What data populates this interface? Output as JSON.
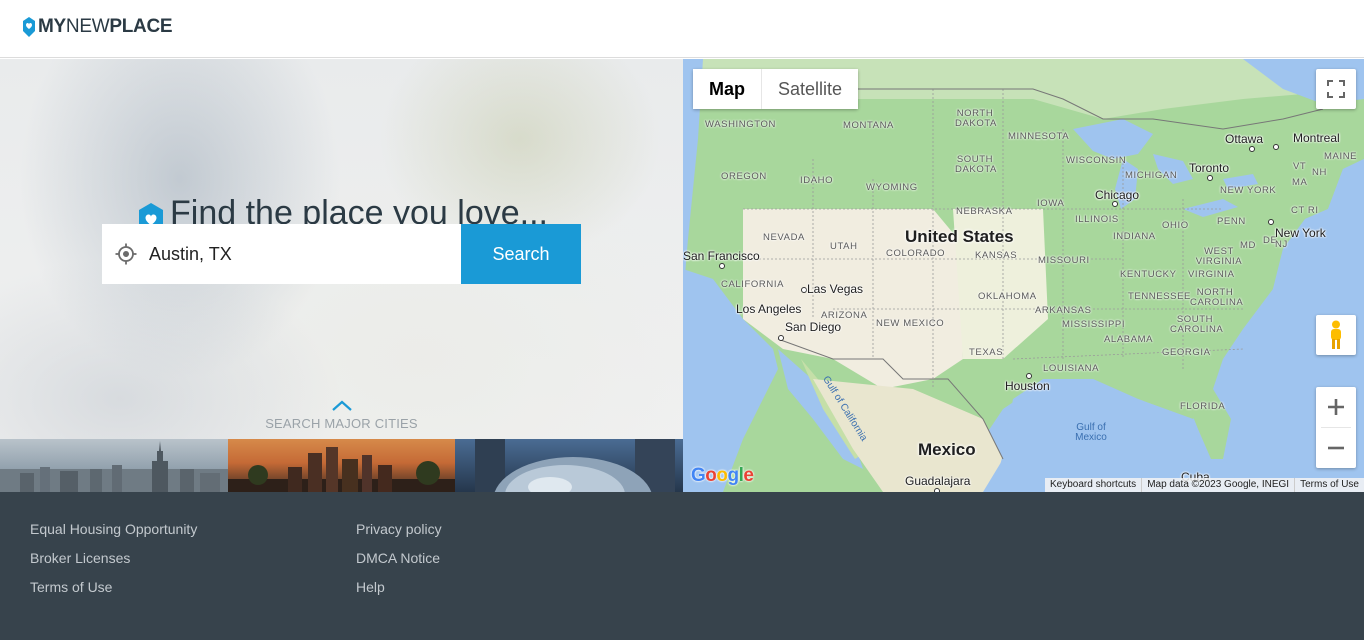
{
  "header": {
    "logo_my": "MY",
    "logo_new": "NEW",
    "logo_place": "PLACE"
  },
  "hero": {
    "title": "Find the place you love...",
    "search": {
      "value": "Austin, TX",
      "button_label": "Search"
    },
    "cities_label": "SEARCH MAJOR CITIES"
  },
  "map": {
    "type_controls": {
      "map": "Map",
      "satellite": "Satellite"
    },
    "google_logo": {
      "letters": [
        "G",
        "o",
        "o",
        "g",
        "l",
        "e"
      ],
      "colors": [
        "#4285F4",
        "#EA4335",
        "#FBBC05",
        "#4285F4",
        "#34A853",
        "#EA4335"
      ]
    },
    "attribution": {
      "shortcuts": "Keyboard shortcuts",
      "data": "Map data ©2023 Google, INEGI",
      "terms": "Terms of Use"
    },
    "labels": {
      "country_us": "United States",
      "country_mx": "Mexico",
      "states": [
        "WASHINGTON",
        "MONTANA",
        "NORTH DAKOTA",
        "MINNESOTA",
        "OREGON",
        "IDAHO",
        "SOUTH DAKOTA",
        "WISCONSIN",
        "MICHIGAN",
        "WYOMING",
        "NEBRASKA",
        "IOWA",
        "ILLINOIS",
        "OHIO",
        "PENN",
        "NEVADA",
        "UTAH",
        "COLORADO",
        "KANSAS",
        "MISSOURI",
        "INDIANA",
        "WEST VIRGINIA",
        "CALIFORNIA",
        "ARIZONA",
        "NEW MEXICO",
        "OKLAHOMA",
        "ARKANSAS",
        "TENNESSEE",
        "KENTUCKY",
        "VIRGINIA",
        "NORTH CAROLINA",
        "SOUTH CAROLINA",
        "MISSISSIPPI",
        "ALABAMA",
        "GEORGIA",
        "TEXAS",
        "LOUISIANA",
        "FLORIDA",
        "NEW YORK",
        "MAINE",
        "VT",
        "NH",
        "MA",
        "CT RI",
        "MD",
        "DE",
        "NJ"
      ],
      "cities": [
        "San Francisco",
        "Las Vegas",
        "Los Angeles",
        "San Diego",
        "Chicago",
        "Toronto",
        "Ottawa",
        "Montreal",
        "New York",
        "Houston",
        "Guadalajara",
        "Cuba"
      ],
      "waters": [
        "Gulf of Mexico",
        "Gulf of California"
      ]
    }
  },
  "footer": {
    "col1": [
      "Equal Housing Opportunity",
      "Broker Licenses",
      "Terms of Use"
    ],
    "col2": [
      "Privacy policy",
      "DMCA Notice",
      "Help"
    ]
  },
  "colors": {
    "accent": "#1a9ad6",
    "footer_bg": "#37434c",
    "title_text": "#2b3a44"
  }
}
